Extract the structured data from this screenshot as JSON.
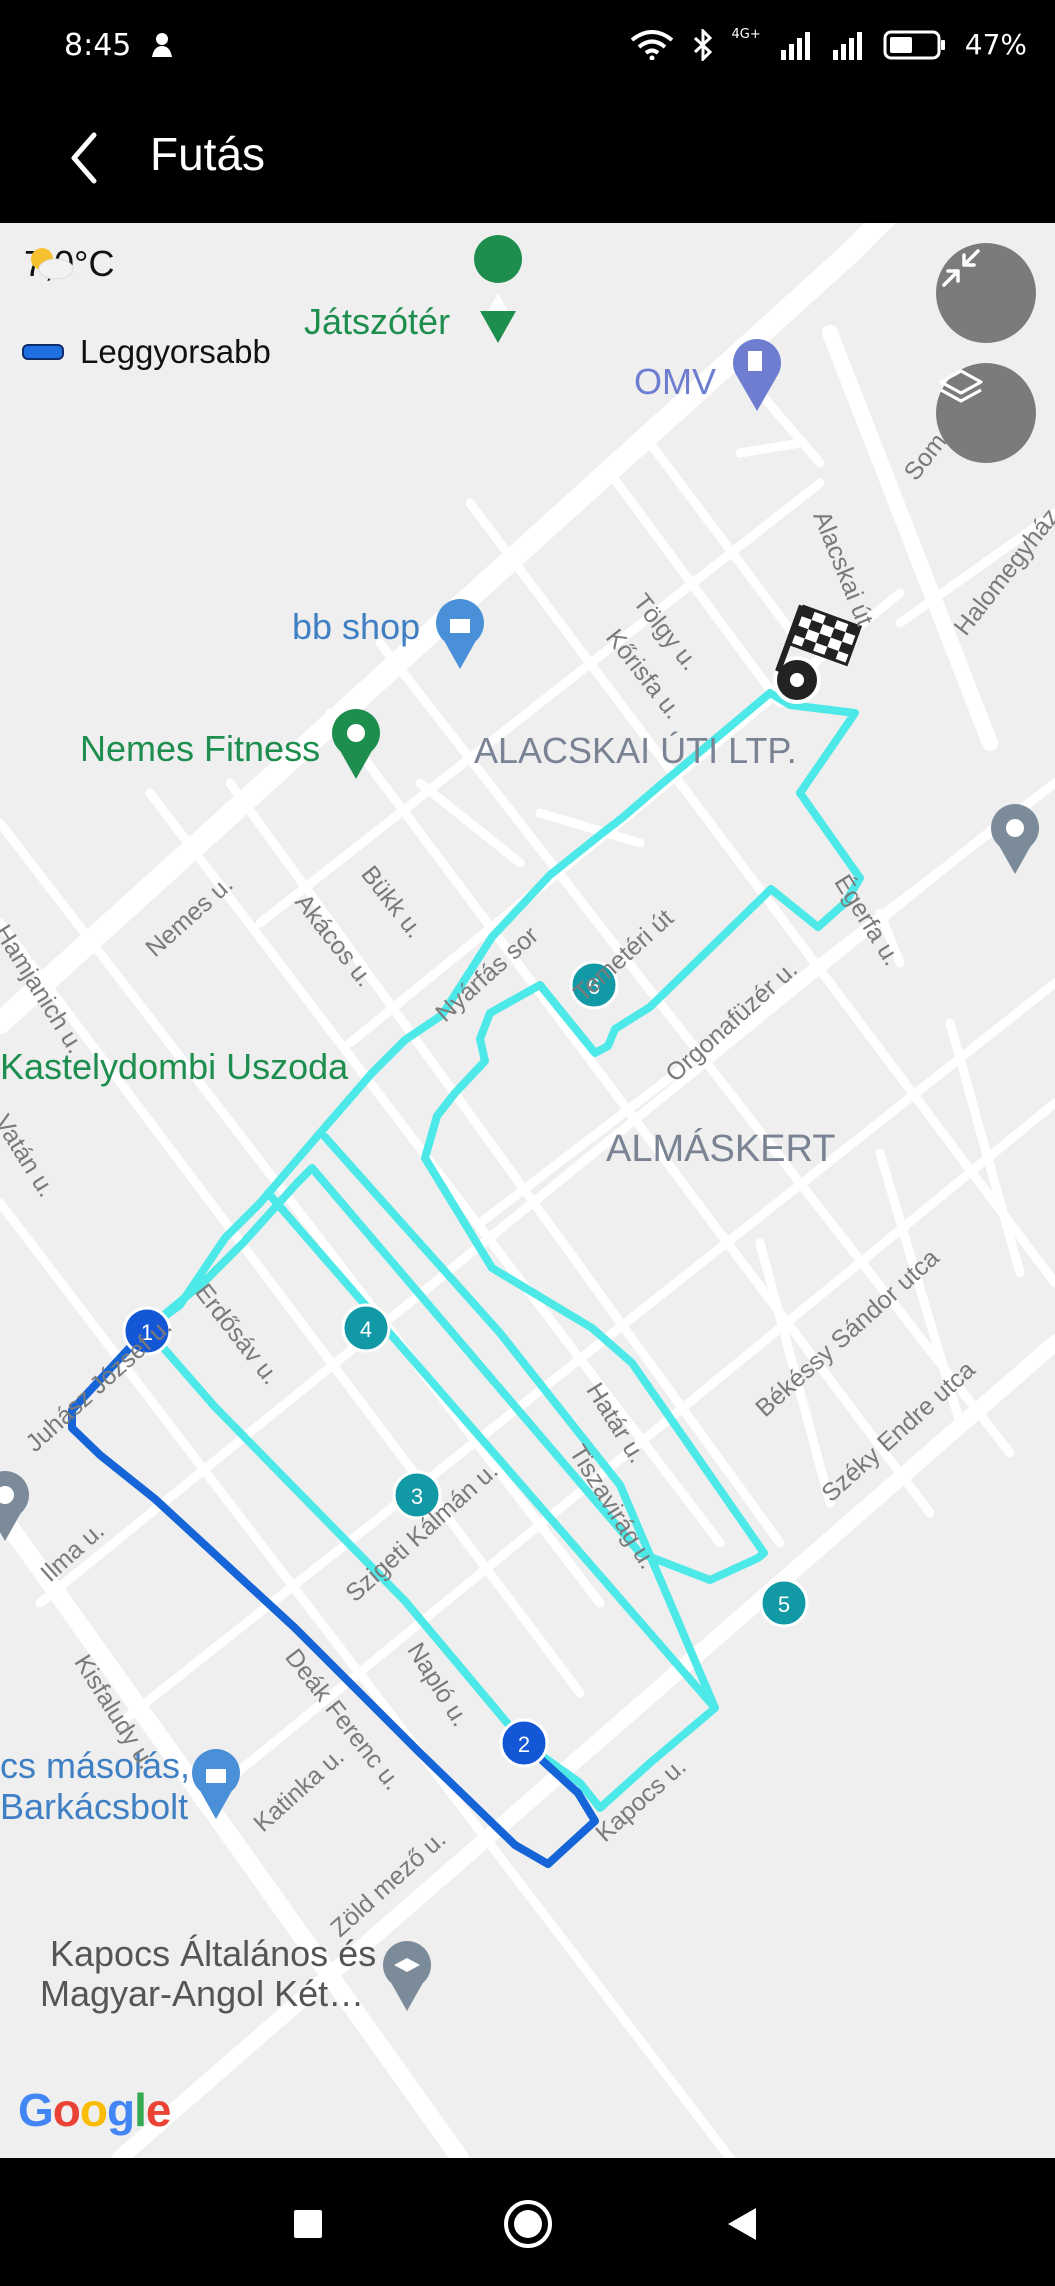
{
  "status_bar": {
    "time": "8:45",
    "network": "4G+",
    "battery": "47%"
  },
  "header": {
    "title": "Futás"
  },
  "weather": {
    "temperature": "7,0°C",
    "icon": "partly-cloudy-icon"
  },
  "legend": {
    "label": "Leggyorsabb",
    "color": "#1f6fe0"
  },
  "colors": {
    "route_main": "#4de8e8",
    "route_fast": "#1565d8",
    "marker_teal": "#119aa6",
    "marker_blue": "#1357d6"
  },
  "map": {
    "districts": [
      "ALACSKAI ÚTI LTP.",
      "ALMÁSKERT"
    ],
    "pois": {
      "playground": "Játszótér",
      "omv": "OMV",
      "bb_shop": "bb shop",
      "fitness": "Nemes Fitness",
      "pool": "Kastelydombi Uszoda",
      "shop_line1": "cs másolás,",
      "shop_line2": "Barkácsbolt",
      "school_line1": "Kapocs Általános és",
      "school_line2": "Magyar-Angol Két…"
    },
    "streets": {
      "tolgy": "Tölgy u.",
      "korisfa": "Kőrisfa u.",
      "alacskai": "Alacskai út",
      "halomegy": "Halomegyház",
      "som": "Som u.",
      "bukk": "Bükk u.",
      "akacos": "Akácos u.",
      "nemes": "Nemes u.",
      "janich": "Hamjanich u.",
      "nyarfas": "Nyárfás sor",
      "temeteri": "Temetéri út",
      "egerfa": "Égerfa u.",
      "orgona": "Orgonafüzér u.",
      "erdosav": "Erdősáv u.",
      "juhasz": "Juhász József u.",
      "hatar": "Határ u.",
      "tiszavirag": "Tiszavirág u.",
      "bekessy": "Békéssy Sándor utca",
      "szeky": "Széky Endre utca",
      "szigeti": "Szigeti Kálmán u.",
      "ilma": "Ilma u.",
      "kisfaludy": "Kisfaludy u.",
      "deak": "Deák Ferenc u.",
      "naplo": "Napló u.",
      "kapocs": "Kapocs u.",
      "katinka": "Katinka u.",
      "zoldmezo": "Zöld mező u.",
      "vatan": "Vatán u."
    },
    "route_markers": [
      "1",
      "2",
      "3",
      "4",
      "5",
      "6"
    ],
    "attribution": {
      "letters": [
        "G",
        "o",
        "o",
        "g",
        "l",
        "e"
      ],
      "colors": [
        "#4285f4",
        "#ea4335",
        "#fbbc05",
        "#4285f4",
        "#34a853",
        "#ea4335"
      ]
    }
  }
}
